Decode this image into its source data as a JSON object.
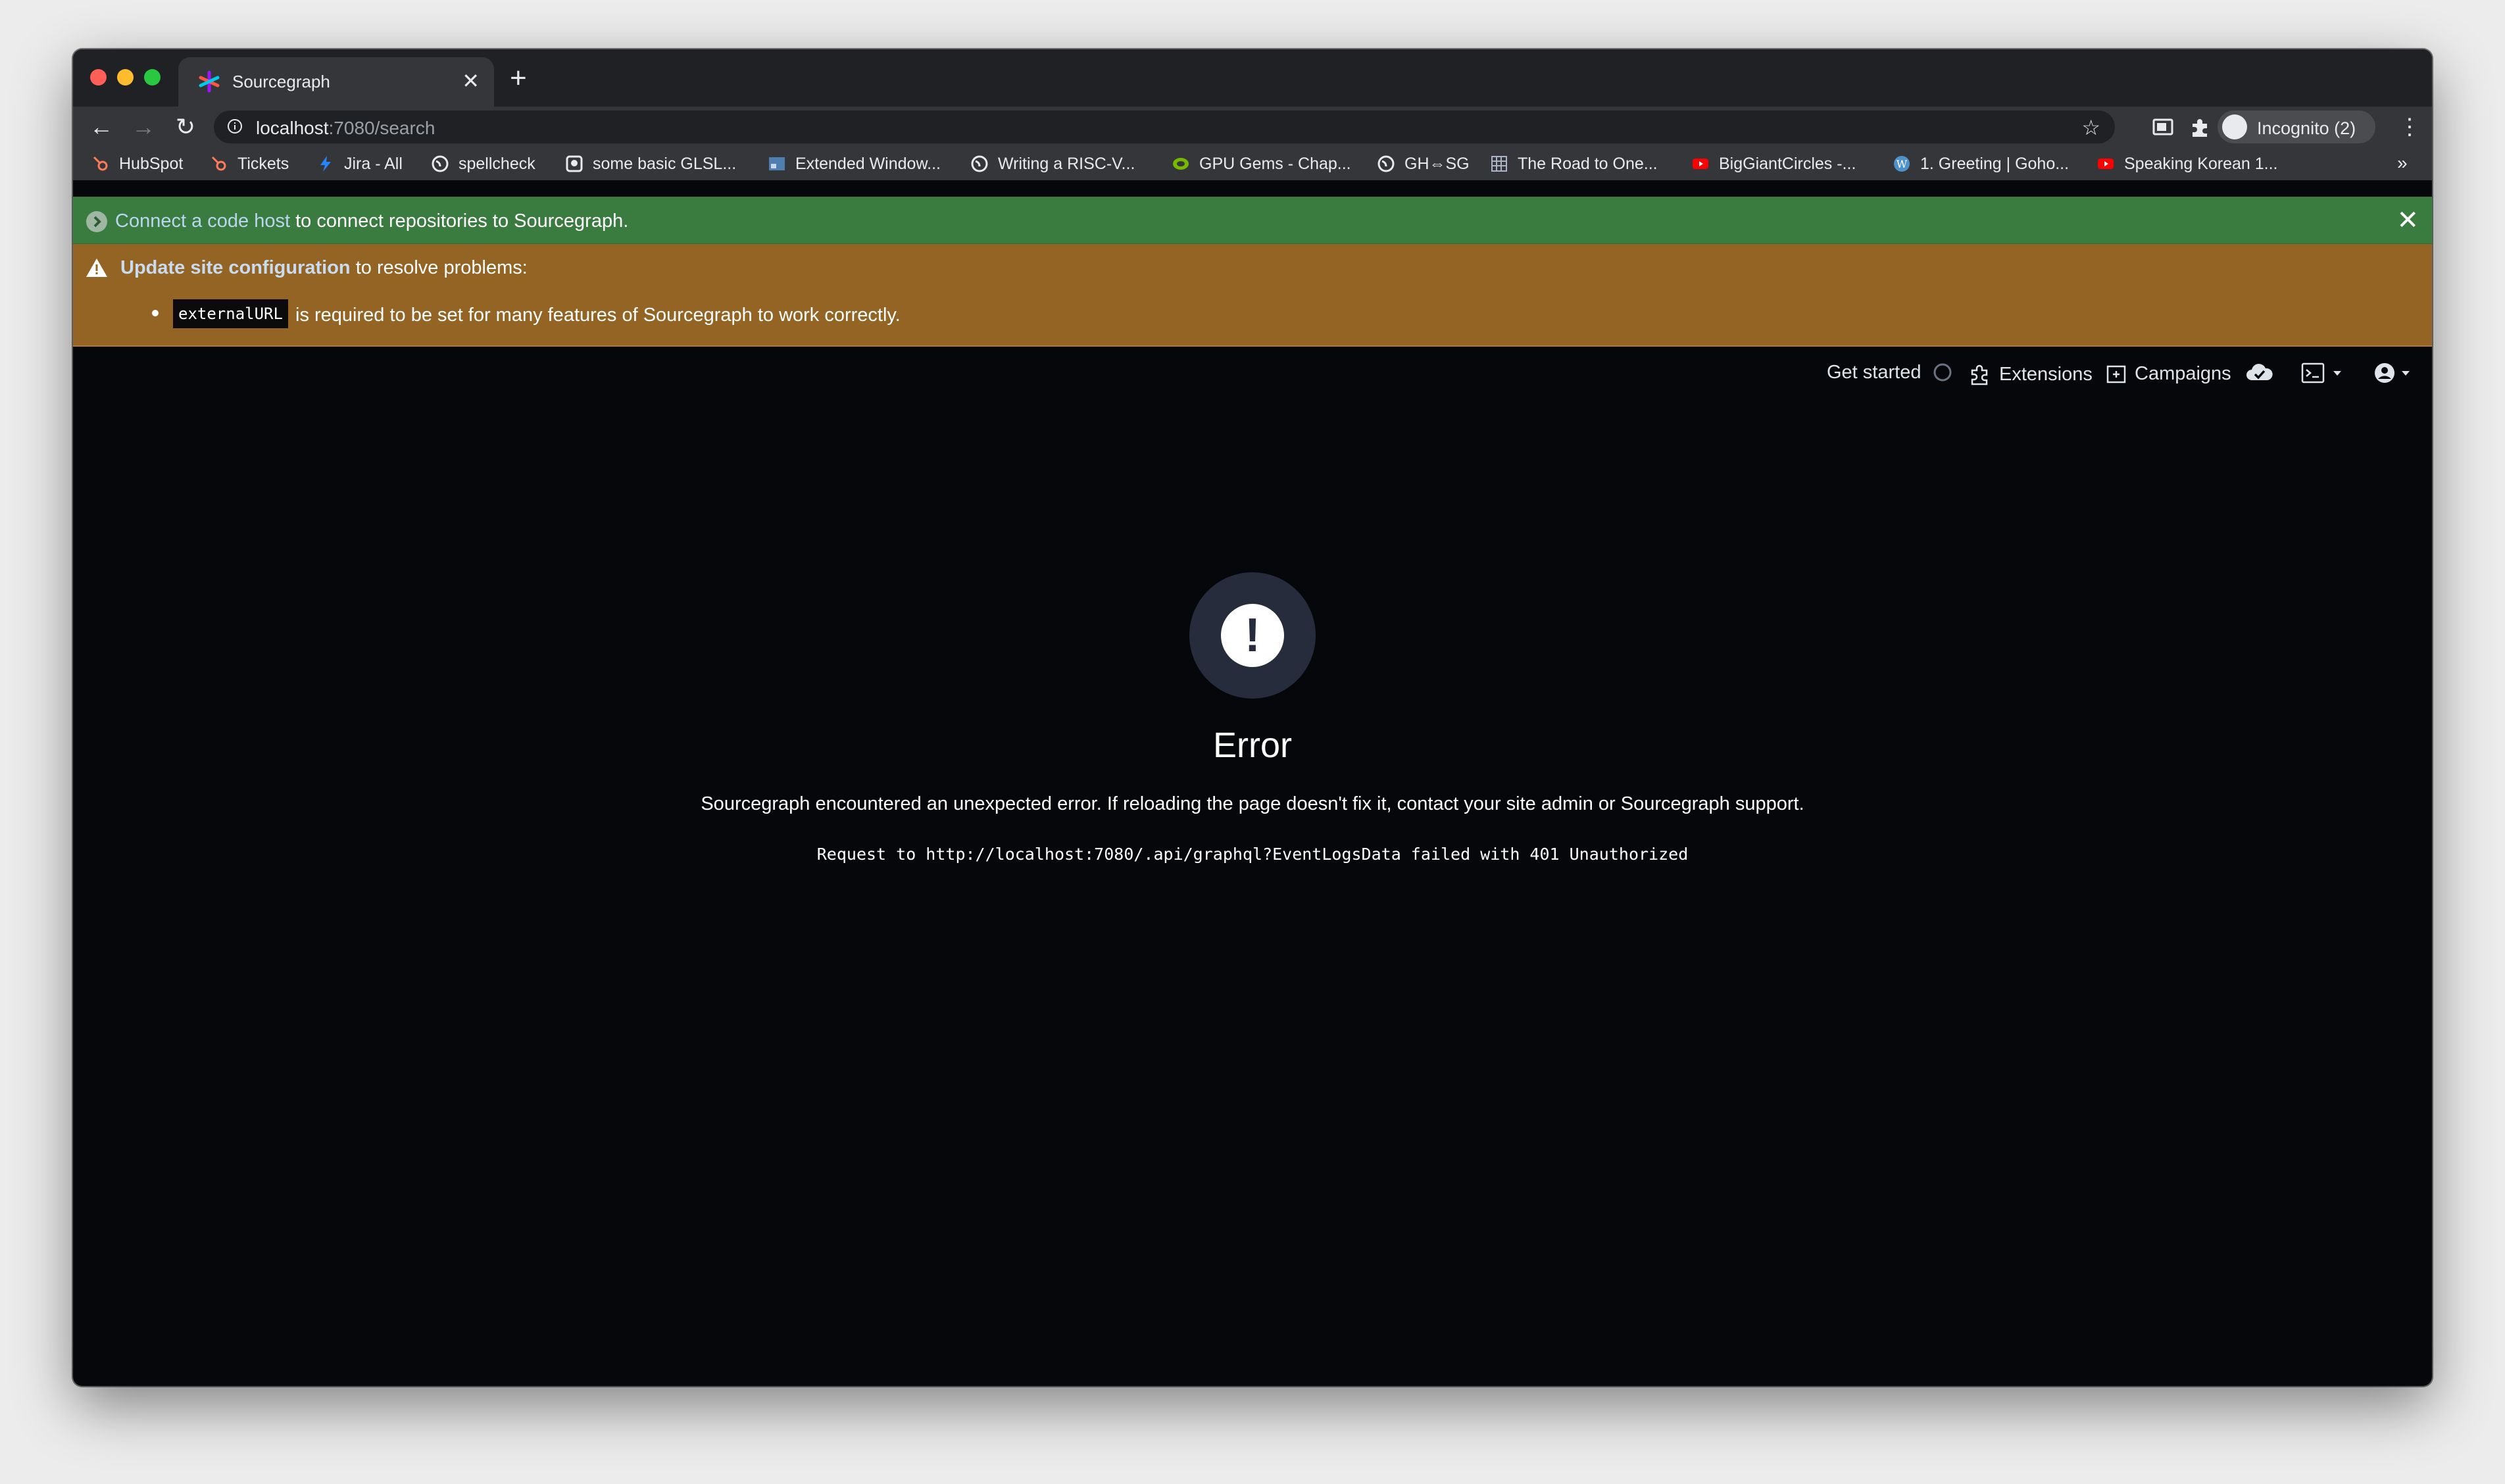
{
  "browser": {
    "tab": {
      "title": "Sourcegraph",
      "favicon": "sourcegraph-favicon"
    },
    "url": {
      "host": "localhost",
      "rest": ":7080/search"
    },
    "profile_label": "Incognito (2)",
    "bookmarks": [
      {
        "label": "HubSpot",
        "icon": "hubspot-icon"
      },
      {
        "label": "Tickets",
        "icon": "hubspot-icon"
      },
      {
        "label": "Jira - All",
        "icon": "jira-icon"
      },
      {
        "label": "spellcheck",
        "icon": "globe-icon"
      },
      {
        "label": "some basic GLSL...",
        "icon": "github-icon"
      },
      {
        "label": "Extended Window...",
        "icon": "image-icon"
      },
      {
        "label": "Writing a RISC-V...",
        "icon": "globe-icon"
      },
      {
        "label": "GPU Gems - Chap...",
        "icon": "nvidia-icon"
      },
      {
        "label": "GH⇔SG",
        "icon": "globe-icon"
      },
      {
        "label": "The Road to One...",
        "icon": "grid-icon"
      },
      {
        "label": "BigGiantCircles -...",
        "icon": "youtube-icon"
      },
      {
        "label": "1. Greeting | Goho...",
        "icon": "wordpress-icon"
      },
      {
        "label": "Speaking Korean 1...",
        "icon": "youtube-icon"
      }
    ],
    "bookmarks_more": "»"
  },
  "alerts": {
    "connect": {
      "link": "Connect a code host",
      "text": " to connect repositories to Sourcegraph."
    },
    "config": {
      "link": "Update site configuration",
      "text": " to resolve problems:",
      "code": "externalURL",
      "problem": "is required to be set for many features of Sourcegraph to work correctly."
    }
  },
  "nav": {
    "get_started": "Get started",
    "extensions": "Extensions",
    "campaigns": "Campaigns"
  },
  "error": {
    "title": "Error",
    "description": "Sourcegraph encountered an unexpected error. If reloading the page doesn't fix it, contact your site admin or Sourcegraph support.",
    "detail": "Request to http://localhost:7080/.api/graphql?EventLogsData failed with 401 Unauthorized"
  }
}
